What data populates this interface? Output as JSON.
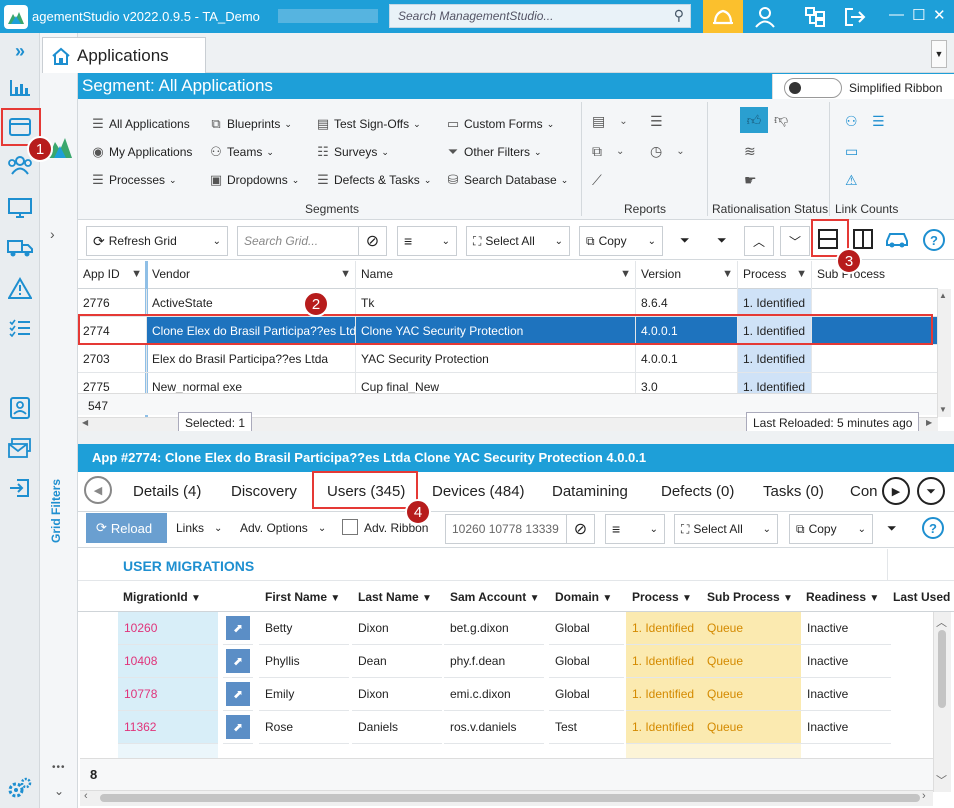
{
  "window": {
    "title": "agementStudio v2022.0.9.5 - TA_Demo",
    "search_placeholder": "Search ManagementStudio...",
    "min": "—",
    "max": "☐",
    "close": "✕"
  },
  "tab": {
    "label": "Applications"
  },
  "segment": {
    "title": "Segment: All Applications",
    "simplified_ribbon": "Simplified Ribbon"
  },
  "ribbon": {
    "segments": {
      "all_apps": "All Applications",
      "my_apps": "My Applications",
      "processes": "Processes",
      "blueprints": "Blueprints",
      "teams": "Teams",
      "dropdowns": "Dropdowns",
      "test_signoffs": "Test Sign-Offs",
      "surveys": "Surveys",
      "defects_tasks": "Defects & Tasks",
      "custom_forms": "Custom Forms",
      "other_filters": "Other Filters",
      "search_database": "Search Database",
      "group_label": "Segments"
    },
    "reports_label": "Reports",
    "rationalisation_label": "Rationalisation Status",
    "link_counts_label": "Link Counts"
  },
  "grid_toolbar": {
    "refresh": "Refresh Grid",
    "search_placeholder": "Search Grid...",
    "select_all": "Select All",
    "copy": "Copy"
  },
  "grid": {
    "columns": [
      "App ID",
      "Vendor",
      "Name",
      "Version",
      "Process",
      "Sub Process"
    ],
    "rows": [
      {
        "id": "2776",
        "vendor": "ActiveState",
        "name": "Tk",
        "version": "8.6.4",
        "process": "1. Identified"
      },
      {
        "id": "2774",
        "vendor": "Clone Elex do Brasil Participa??es Ltda",
        "name": "Clone YAC Security Protection",
        "version": "4.0.0.1",
        "process": "1. Identified"
      },
      {
        "id": "2703",
        "vendor": "Elex do Brasil Participa??es Ltda",
        "name": "YAC Security Protection",
        "version": "4.0.0.1",
        "process": "1. Identified"
      },
      {
        "id": "2775",
        "vendor": "New_normal exe",
        "name": "Cup final_New",
        "version": "3.0",
        "process": "1. Identified"
      }
    ],
    "count": "547",
    "selected": "Selected: 1",
    "last_reloaded": "Last Reloaded: 5 minutes ago"
  },
  "detail": {
    "header": "App #2774: Clone Elex do Brasil Participa??es Ltda Clone YAC Security Protection 4.0.0.1",
    "tabs": [
      "Details (4)",
      "Discovery",
      "Users (345)",
      "Devices (484)",
      "Datamining",
      "Defects (0)",
      "Tasks (0)",
      "Con"
    ],
    "toolbar": {
      "reload": "Reload",
      "links": "Links",
      "adv_options": "Adv. Options",
      "adv_ribbon": "Adv. Ribbon",
      "ids": "10260 10778 13339",
      "select_all": "Select All",
      "copy": "Copy"
    },
    "section": "USER MIGRATIONS",
    "columns": [
      "MigrationId",
      "First Name",
      "Last Name",
      "Sam Account",
      "Domain",
      "Process",
      "Sub Process",
      "Readiness",
      "Last Used"
    ],
    "rows": [
      {
        "mid": "10260",
        "first": "Betty",
        "last": "Dixon",
        "sam": "bet.g.dixon",
        "domain": "Global",
        "process": "1. Identified",
        "sub": "Queue",
        "ready": "Inactive"
      },
      {
        "mid": "10408",
        "first": "Phyllis",
        "last": "Dean",
        "sam": "phy.f.dean",
        "domain": "Global",
        "process": "1. Identified",
        "sub": "Queue",
        "ready": "Inactive"
      },
      {
        "mid": "10778",
        "first": "Emily",
        "last": "Dixon",
        "sam": "emi.c.dixon",
        "domain": "Global",
        "process": "1. Identified",
        "sub": "Queue",
        "ready": "Inactive"
      },
      {
        "mid": "11362",
        "first": "Rose",
        "last": "Daniels",
        "sam": "ros.v.daniels",
        "domain": "Test",
        "process": "1. Identified",
        "sub": "Queue",
        "ready": "Inactive"
      }
    ],
    "count": "8",
    "grid_filters": "Grid Filters"
  },
  "callouts": [
    "1",
    "2",
    "3",
    "4"
  ]
}
